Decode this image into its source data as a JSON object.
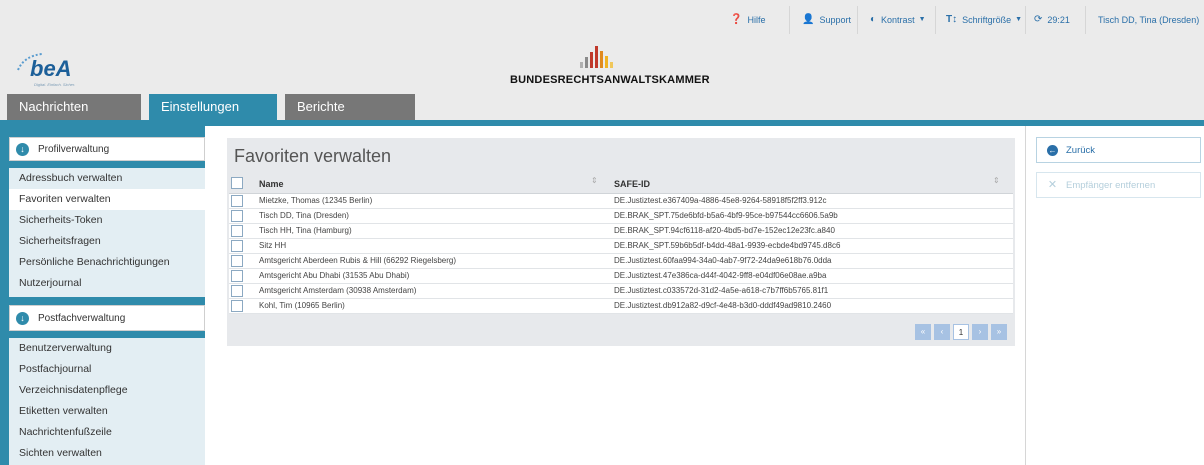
{
  "topbar": {
    "hilfe": "Hilfe",
    "support": "Support",
    "kontrast": "Kontrast",
    "schriftgroesse": "Schriftgröße",
    "timer": "29:21",
    "user": "Tisch DD, Tina (Dresden)"
  },
  "header": {
    "bea_word": "beA",
    "bea_tagline": "Digital. Einfach. Sicher.",
    "brak_name": "BUNDESRECHTSANWALTSKAMMER"
  },
  "tabs": [
    {
      "label": "Nachrichten"
    },
    {
      "label": "Einstellungen"
    },
    {
      "label": "Berichte"
    }
  ],
  "sidebar": {
    "profil_title": "Profilverwaltung",
    "profil_items": [
      {
        "label": "Adressbuch verwalten"
      },
      {
        "label": "Favoriten verwalten"
      },
      {
        "label": "Sicherheits-Token"
      },
      {
        "label": "Sicherheitsfragen"
      },
      {
        "label": "Persönliche Benachrichtigungen"
      },
      {
        "label": "Nutzerjournal"
      }
    ],
    "postfach_title": "Postfachverwaltung",
    "postfach_items": [
      {
        "label": "Benutzerverwaltung"
      },
      {
        "label": "Postfachjournal"
      },
      {
        "label": "Verzeichnisdatenpflege"
      },
      {
        "label": "Etiketten verwalten"
      },
      {
        "label": "Nachrichtenfußzeile"
      },
      {
        "label": "Sichten verwalten"
      }
    ]
  },
  "main": {
    "title": "Favoriten verwalten",
    "col_name": "Name",
    "col_safe": "SAFE-ID",
    "rows": [
      {
        "name": "Mietzke, Thomas (12345 Berlin)",
        "safe": "DE.Justiztest.e367409a-4886-45e8-9264-58918f5f2ff3.912c"
      },
      {
        "name": "Tisch DD, Tina (Dresden)",
        "safe": "DE.BRAK_SPT.75de6bfd-b5a6-4bf9-95ce-b97544cc6606.5a9b"
      },
      {
        "name": "Tisch HH, Tina (Hamburg)",
        "safe": "DE.BRAK_SPT.94cf6118-af20-4bd5-bd7e-152ec12e23fc.a840"
      },
      {
        "name": "Sitz HH",
        "safe": "DE.BRAK_SPT.59b6b5df-b4dd-48a1-9939-ecbde4bd9745.d8c6"
      },
      {
        "name": "Amtsgericht Aberdeen Rubis & Hill (66292 Riegelsberg)",
        "safe": "DE.Justiztest.60faa994-34a0-4ab7-9f72-24da9e618b76.0dda"
      },
      {
        "name": "Amtsgericht Abu Dhabi (31535 Abu Dhabi)",
        "safe": "DE.Justiztest.47e386ca-d44f-4042-9ff8-e04df06e08ae.a9ba"
      },
      {
        "name": "Amtsgericht Amsterdam (30938 Amsterdam)",
        "safe": "DE.Justiztest.c033572d-31d2-4a5e-a618-c7b7ff6b5765.81f1"
      },
      {
        "name": "Kohl, Tim (10965 Berlin)",
        "safe": "DE.Justiztest.db912a82-d9cf-4e48-b3d0-dddf49ad9810.2460"
      }
    ],
    "pager": {
      "first": "«",
      "prev": "‹",
      "current": "1",
      "next": "›",
      "last": "»"
    }
  },
  "right": {
    "back": "Zurück",
    "remove": "Empfänger entfernen"
  },
  "colors": {
    "accent": "#2f8bab",
    "tab_gray": "#777777",
    "link": "#2a6fa8"
  }
}
